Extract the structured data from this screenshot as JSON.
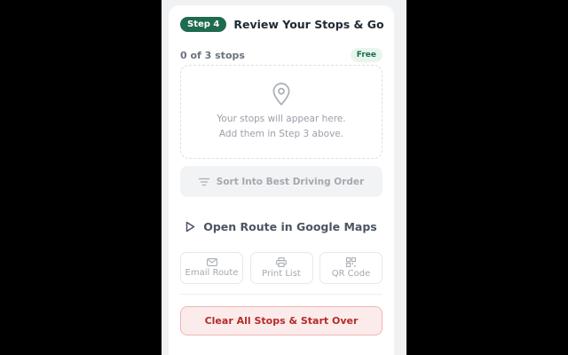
{
  "step": {
    "badge": "Step 4",
    "title": "Review Your Stops & Go"
  },
  "stops": {
    "count_text": "0 of 3 stops",
    "plan_badge": "Free"
  },
  "empty_state": {
    "icon": "map-pin-icon",
    "line1": "Your stops will appear here.",
    "line2": "Add them in Step 3 above."
  },
  "sort_button": {
    "icon": "sort-lines-icon",
    "label": "Sort Into Best Driving Order"
  },
  "maps_button": {
    "icon": "play-icon",
    "label": "Open Route in Google Maps"
  },
  "actions": [
    {
      "icon": "mail-icon",
      "label": "Email Route"
    },
    {
      "icon": "printer-icon",
      "label": "Print List"
    },
    {
      "icon": "qr-code-icon",
      "label": "QR Code"
    }
  ],
  "clear_button": {
    "label": "Clear All Stops & Start Over"
  },
  "colors": {
    "brand_green": "#1e6b4f",
    "free_bg": "#e7f6ec",
    "danger_text": "#b42b2b",
    "danger_bg": "#fcebeb",
    "danger_border": "#f0b6b6",
    "muted_text": "#a4a9b0",
    "background": "#000000"
  }
}
